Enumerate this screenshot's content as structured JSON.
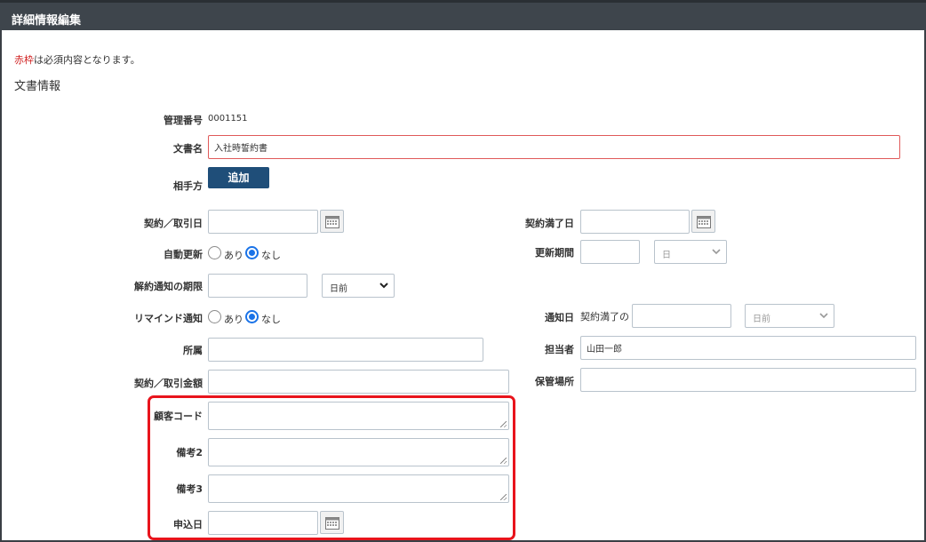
{
  "header": {
    "title": "詳細情報編集"
  },
  "note": {
    "red_text": "赤枠",
    "rest_text": "は必須内容となります。"
  },
  "section": {
    "title": "文書情報"
  },
  "fields": {
    "management_no": {
      "label": "管理番号",
      "value": "0001151"
    },
    "doc_name": {
      "label": "文書名",
      "value": "入社時誓約書"
    },
    "counterparty": {
      "label": "相手方",
      "button": "追加"
    },
    "contract_date": {
      "label": "契約／取引日",
      "value": ""
    },
    "contract_expiry": {
      "label": "契約満了日",
      "value": ""
    },
    "auto_renew": {
      "label": "自動更新",
      "option_yes": "あり",
      "option_no": "なし",
      "selected": "なし"
    },
    "renew_period": {
      "label": "更新期間",
      "value": "",
      "unit": "日"
    },
    "cancel_notice": {
      "label": "解約通知の期限",
      "value": "",
      "unit": "日前"
    },
    "remind": {
      "label": "リマインド通知",
      "option_yes": "あり",
      "option_no": "なし",
      "selected": "なし"
    },
    "notify_date": {
      "label": "通知日",
      "prefix": "契約満了の",
      "value": "",
      "unit": "日前"
    },
    "department": {
      "label": "所属",
      "value": ""
    },
    "person": {
      "label": "担当者",
      "value": "山田一郎"
    },
    "amount": {
      "label": "契約／取引金額",
      "value": ""
    },
    "storage": {
      "label": "保管場所",
      "value": ""
    },
    "customer_code": {
      "label": "顧客コード",
      "value": ""
    },
    "remarks2": {
      "label": "備考2",
      "value": ""
    },
    "remarks3": {
      "label": "備考3",
      "value": ""
    },
    "apply_date": {
      "label": "申込日",
      "value": ""
    }
  },
  "colors": {
    "header_bg": "#3e454c",
    "button_bg": "#1f4e79",
    "required_border": "#e05a5a",
    "highlight": "#e8141c",
    "radio_on": "#1a73e8"
  }
}
